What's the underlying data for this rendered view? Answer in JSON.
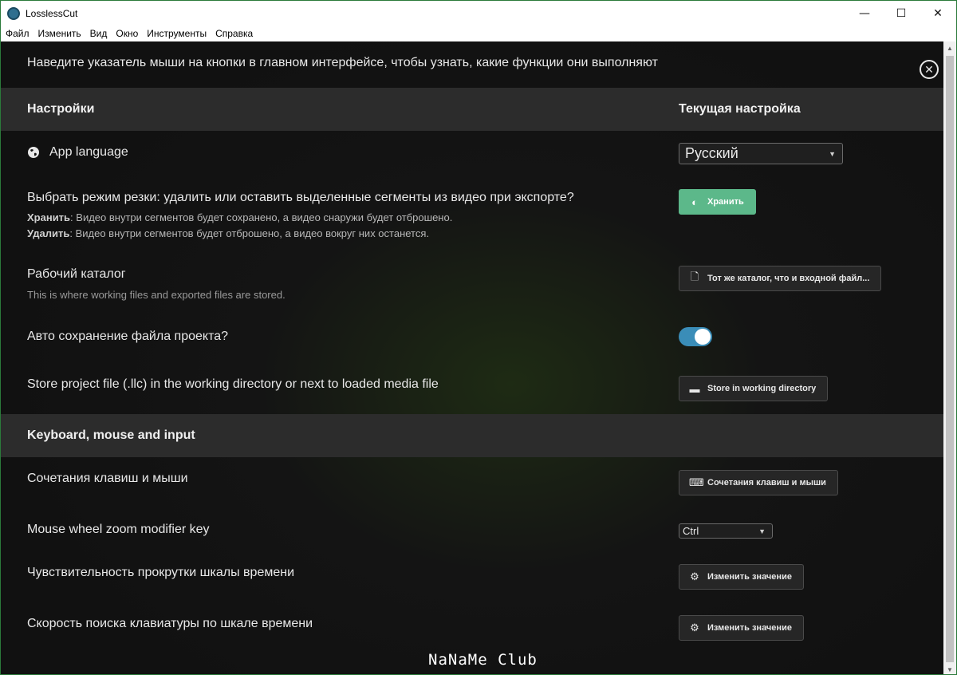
{
  "window": {
    "title": "LosslessCut",
    "controls": {
      "minimize": "—",
      "maximize": "☐",
      "close": "✕"
    }
  },
  "menu": [
    "Файл",
    "Изменить",
    "Вид",
    "Окно",
    "Инструменты",
    "Справка"
  ],
  "hint": "Наведите указатель мыши на кнопки в главном интерфейсе, чтобы узнать, какие функции они выполняют",
  "close_icon": "✕",
  "headers": {
    "settings": "Настройки",
    "current": "Текущая настройка",
    "keyboard": "Keyboard, mouse and input"
  },
  "rows": {
    "language": {
      "title": "App language",
      "value": "Русский",
      "icon": "globe-icon"
    },
    "cut_mode": {
      "title": "Выбрать режим резки: удалить или оставить выделенные сегменты из видео при экспорте?",
      "keep_label": "Хранить",
      "keep_desc": ": Видео внутри сегментов будет сохранено, а видео снаружи будет отброшено.",
      "delete_label": "Удалить",
      "delete_desc": ": Видео внутри сегментов будет отброшено, а видео вокруг них останется.",
      "button": "Хранить"
    },
    "working_dir": {
      "title": "Рабочий каталог",
      "desc": "This is where working files and exported files are stored.",
      "button": "Тот же каталог, что и входной файл..."
    },
    "autosave": {
      "title": "Авто сохранение файла проекта?",
      "enabled": true
    },
    "store_project": {
      "title": "Store project file (.llc) in the working directory or next to loaded media file",
      "button": "Store in working directory"
    },
    "shortcuts": {
      "title": "Сочетания клавиш и мыши",
      "button": "Сочетания клавиш и мыши"
    },
    "zoom_modifier": {
      "title": "Mouse wheel zoom modifier key",
      "value": "Ctrl"
    },
    "scroll_sensitivity": {
      "title": "Чувствительность прокрутки шкалы времени",
      "button": "Изменить значение"
    },
    "keyboard_seek": {
      "title": "Скорость поиска клавиатуры по шкале времени",
      "button": "Изменить значение"
    }
  },
  "watermark": "NaNaMe Club",
  "colors": {
    "accent_green": "#5cb88a",
    "toggle_blue": "#3a8db8",
    "border_green": "#2b7a3a"
  }
}
